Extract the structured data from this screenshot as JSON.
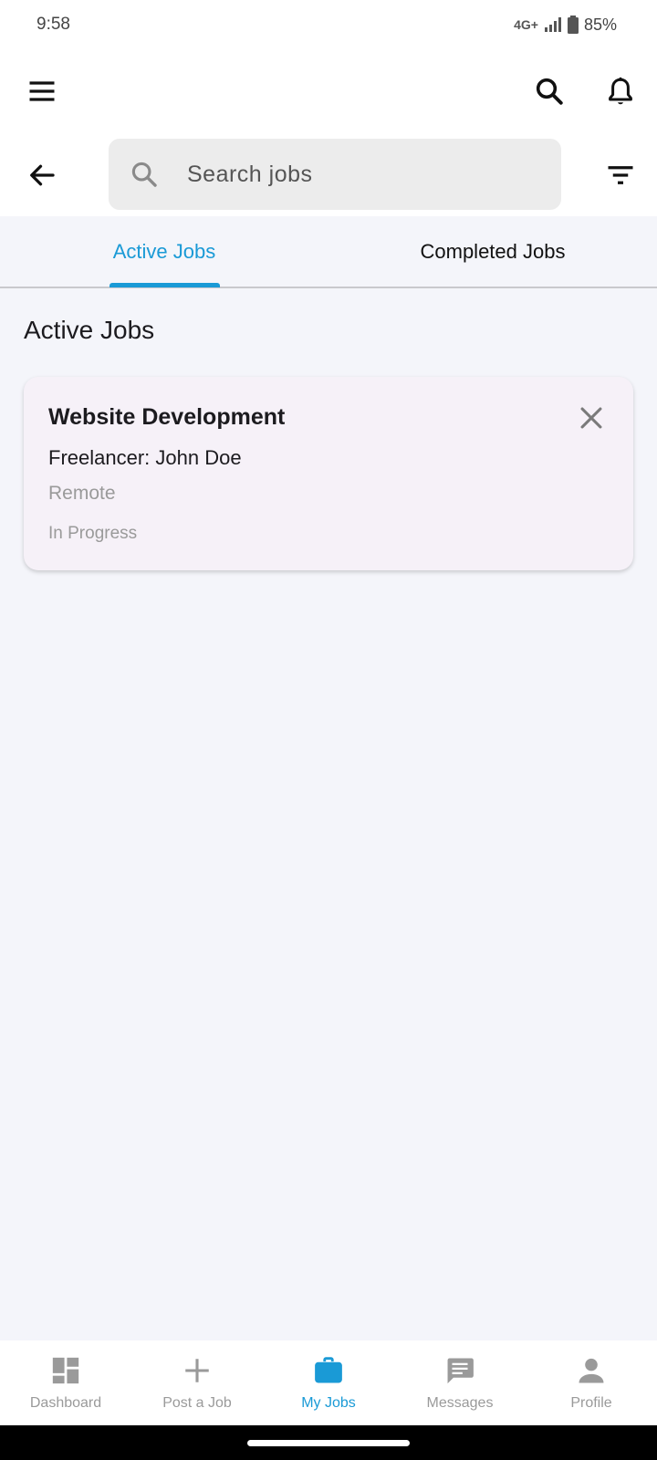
{
  "status_bar": {
    "time": "9:58",
    "network": "4G+",
    "battery": "85%"
  },
  "search": {
    "placeholder": "Search jobs"
  },
  "tabs": [
    {
      "label": "Active Jobs",
      "active": true
    },
    {
      "label": "Completed Jobs",
      "active": false
    }
  ],
  "section_title": "Active Jobs",
  "jobs": [
    {
      "title": "Website Development",
      "freelancer": "Freelancer: John Doe",
      "location": "Remote",
      "status": "In Progress"
    }
  ],
  "bottom_nav": [
    {
      "label": "Dashboard",
      "icon": "dashboard-icon",
      "active": false
    },
    {
      "label": "Post a Job",
      "icon": "plus-icon",
      "active": false
    },
    {
      "label": "My Jobs",
      "icon": "briefcase-icon",
      "active": true
    },
    {
      "label": "Messages",
      "icon": "message-icon",
      "active": false
    },
    {
      "label": "Profile",
      "icon": "person-icon",
      "active": false
    }
  ],
  "colors": {
    "accent": "#1a9ad6",
    "background": "#f4f5fa",
    "card": "#f6f1f8",
    "muted_text": "#9a9a9a"
  }
}
